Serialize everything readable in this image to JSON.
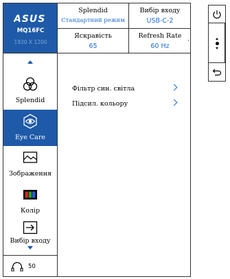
{
  "header": {
    "brand": "ASUS",
    "model": "MQ16FC",
    "resolution": "1920 X 1200",
    "splendid": {
      "label": "Splendid",
      "value": "Стандартний режим"
    },
    "input": {
      "label": "Вибір входу",
      "value": "USB-C-2"
    },
    "brightness": {
      "label": "Яскравість",
      "value": "65"
    },
    "refresh_rate": {
      "label": "Refresh Rate",
      "value": "60 Hz"
    }
  },
  "nav": {
    "items": [
      {
        "label": "Splendid",
        "icon": "splendid-icon",
        "active": false
      },
      {
        "label": "Eye Care",
        "icon": "eye-icon",
        "active": true
      },
      {
        "label": "Зображення",
        "icon": "image-icon",
        "active": false
      },
      {
        "label": "Колір",
        "icon": "color-icon",
        "active": false
      },
      {
        "label": "Вибір входу",
        "icon": "input-select-icon",
        "active": false
      }
    ]
  },
  "footer": {
    "volume": "50",
    "icon": "headphones-icon"
  },
  "content": {
    "items": [
      {
        "label": "Фільтр син. світла"
      },
      {
        "label": "Підсил. кольору"
      }
    ]
  },
  "keys": [
    "power-icon",
    "navigation-joystick-icon",
    "back-icon"
  ],
  "colors": {
    "accent": "#1e5aa8",
    "value_text": "#1e6bd6",
    "resolution_text": "#7ea6dc"
  }
}
